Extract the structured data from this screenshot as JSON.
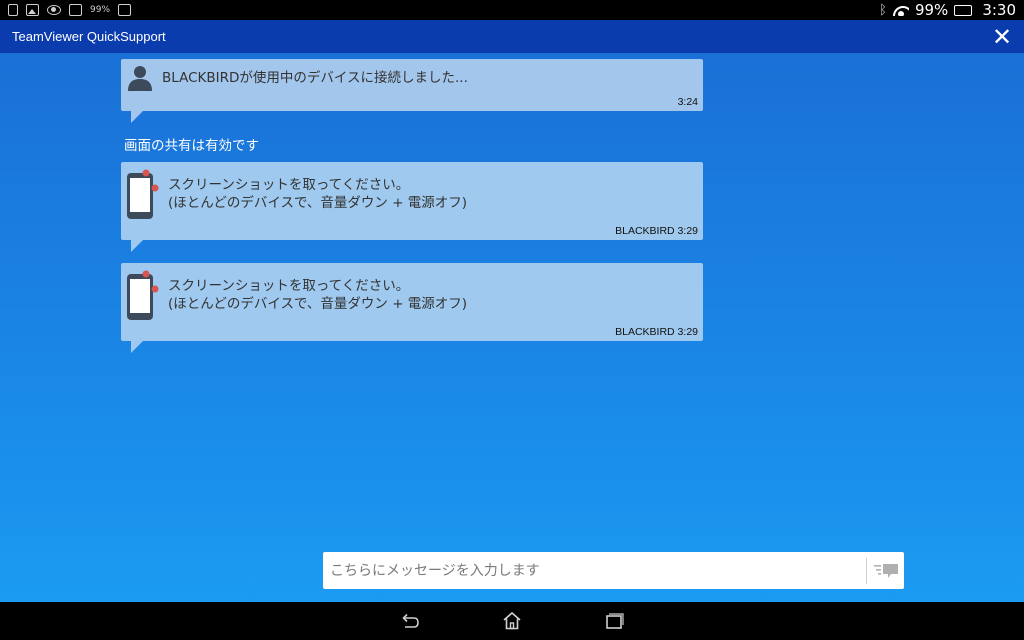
{
  "status_bar": {
    "left_text": "99%",
    "battery_percent": "99%",
    "time": "3:30",
    "battery_color": "#8ed600"
  },
  "app": {
    "title": "TeamViewer QuickSupport",
    "accent": "#0a3cae"
  },
  "messages": [
    {
      "icon": "person-icon",
      "text": "BLACKBIRDが使用中のデバイスに接続しました...",
      "meta": "3:24"
    },
    {
      "icon": "phone-icon",
      "line1": "スクリーンショットを取ってください。",
      "line2": "(ほとんどのデバイスで、音量ダウン + 電源オフ)",
      "meta": "BLACKBIRD 3:29"
    },
    {
      "icon": "phone-icon",
      "line1": "スクリーンショットを取ってください。",
      "line2": "(ほとんどのデバイスで、音量ダウン + 電源オフ)",
      "meta": "BLACKBIRD 3:29"
    }
  ],
  "system_note": "画面の共有は有効です",
  "input": {
    "placeholder": "こちらにメッセージを入力します",
    "value": ""
  },
  "nav": [
    "back-icon",
    "home-icon",
    "recent-apps-icon"
  ]
}
